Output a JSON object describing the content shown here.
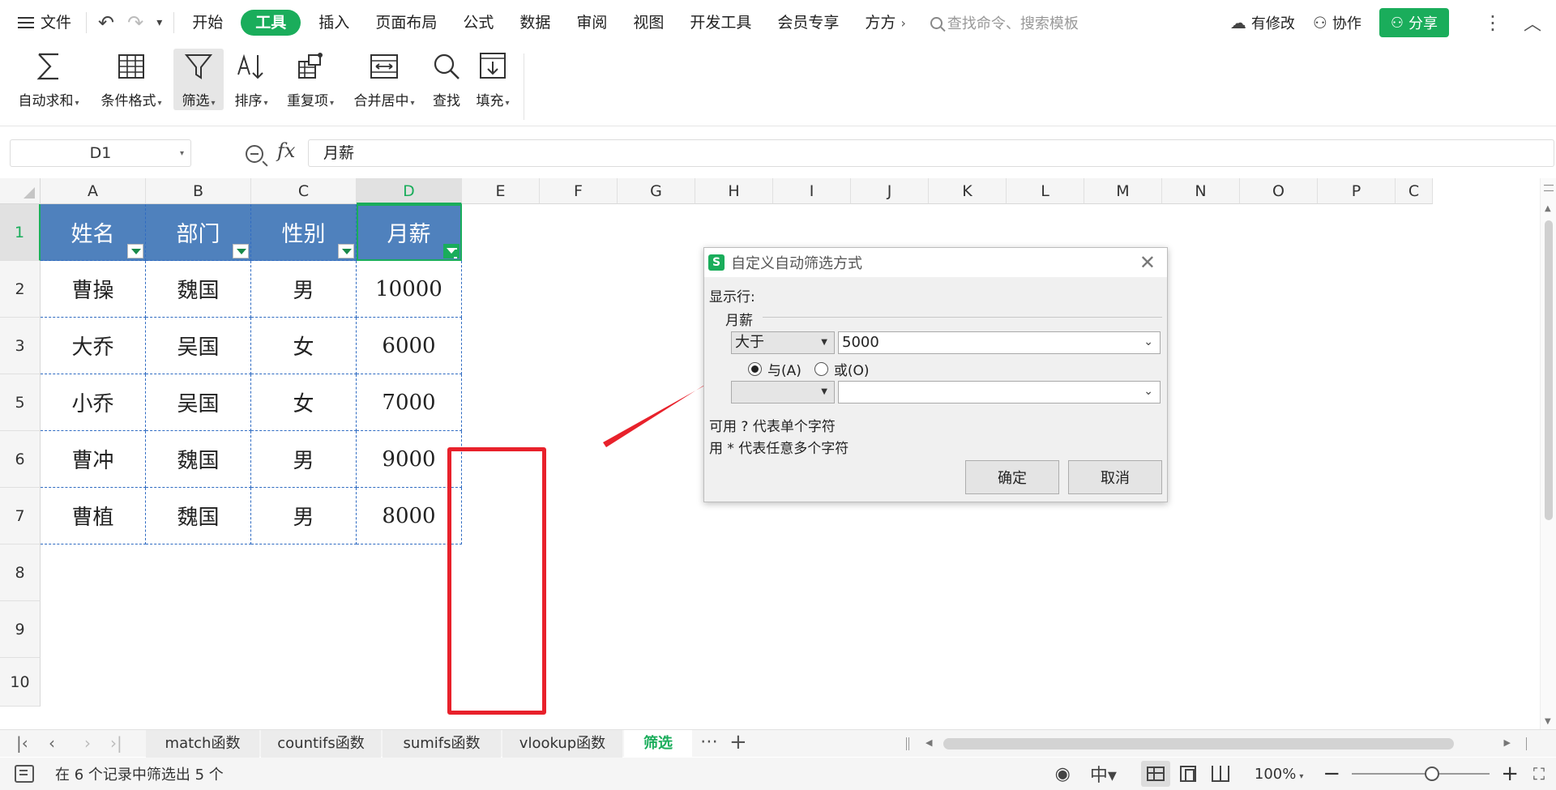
{
  "menu": {
    "file": "文件",
    "tabs": [
      "开始",
      "工具",
      "插入",
      "页面布局",
      "公式",
      "数据",
      "审阅",
      "视图",
      "开发工具",
      "会员专享",
      "方方"
    ],
    "active_tab": "工具",
    "search_placeholder": "查找命令、搜索模板",
    "modified": "有修改",
    "collab": "协作",
    "share": "分享"
  },
  "ribbon": {
    "autosum": "自动求和",
    "cond_format": "条件格式",
    "filter": "筛选",
    "sort": "排序",
    "duplicates": "重复项",
    "merge_center": "合并居中",
    "find": "查找",
    "fill": "填充"
  },
  "formula_bar": {
    "name_box": "D1",
    "fx": "fx",
    "content": "月薪"
  },
  "grid": {
    "columns": [
      "A",
      "B",
      "C",
      "D",
      "E",
      "F",
      "G",
      "H",
      "I",
      "J",
      "K",
      "L",
      "M",
      "N",
      "O",
      "P",
      "C"
    ],
    "selected_column": "D",
    "rows": [
      "1",
      "2",
      "3",
      "5",
      "6",
      "7",
      "8",
      "9",
      "10"
    ],
    "headers": [
      "姓名",
      "部门",
      "性别",
      "月薪"
    ],
    "data": [
      [
        "曹操",
        "魏国",
        "男",
        "10000"
      ],
      [
        "大乔",
        "吴国",
        "女",
        "6000"
      ],
      [
        "小乔",
        "吴国",
        "女",
        "7000"
      ],
      [
        "曹冲",
        "魏国",
        "男",
        "9000"
      ],
      [
        "曹植",
        "魏国",
        "男",
        "8000"
      ]
    ]
  },
  "dialog": {
    "title": "自定义自动筛选方式",
    "show_rows": "显示行:",
    "field": "月薪",
    "operator1": "大于",
    "value1": "5000",
    "and_label": "与(A)",
    "or_label": "或(O)",
    "selected": "and",
    "operator2": "",
    "value2": "",
    "hint1": "可用 ? 代表单个字符",
    "hint2": "用 * 代表任意多个字符",
    "ok": "确定",
    "cancel": "取消"
  },
  "sheets": {
    "tabs": [
      "match函数",
      "countifs函数",
      "sumifs函数",
      "vlookup函数",
      "筛选"
    ],
    "active": "筛选"
  },
  "status": {
    "text": "在 6 个记录中筛选出 5 个",
    "zoom": "100%",
    "zoom_level": 0.58
  },
  "colors": {
    "accent": "#1aad5b",
    "header_fill": "#4f81bd",
    "highlight_red": "#e8212b"
  }
}
